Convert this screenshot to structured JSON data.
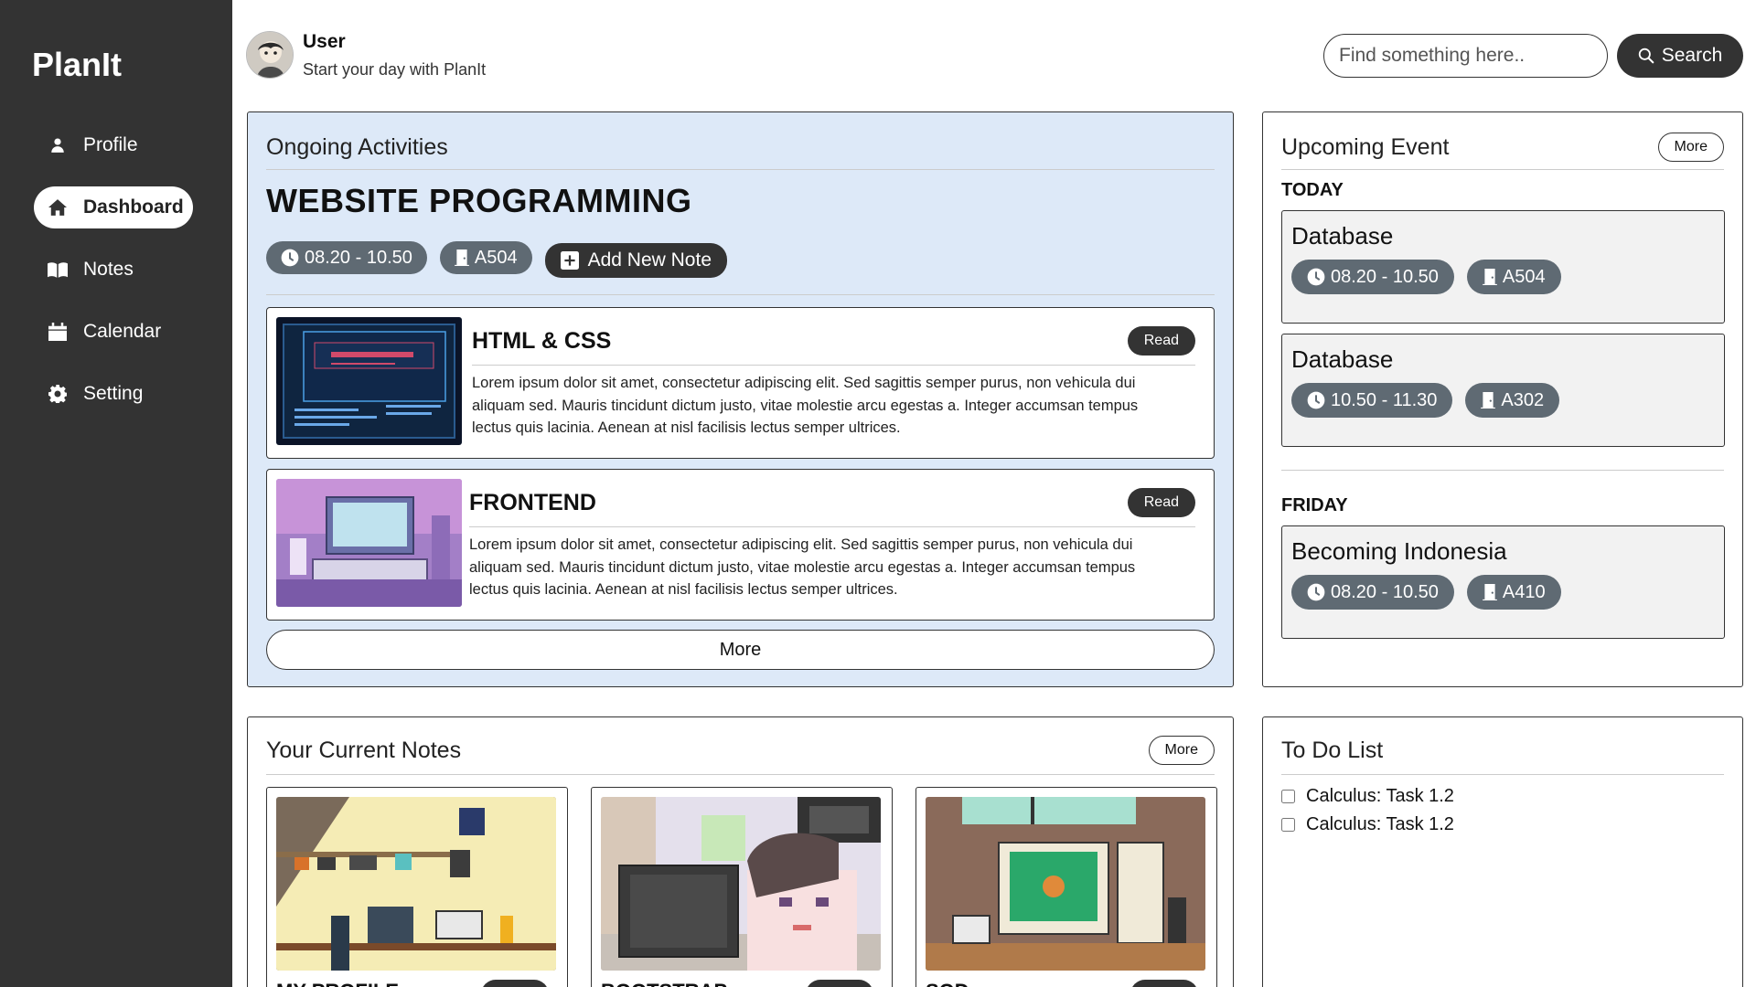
{
  "app": {
    "brand": "PlanIt"
  },
  "sidebar": {
    "items": [
      {
        "label": "Profile",
        "icon": "person-icon",
        "active": false
      },
      {
        "label": "Dashboard",
        "icon": "home-icon",
        "active": true
      },
      {
        "label": "Notes",
        "icon": "book-icon",
        "active": false
      },
      {
        "label": "Calendar",
        "icon": "calendar-icon",
        "active": false
      },
      {
        "label": "Setting",
        "icon": "gear-icon",
        "active": false
      }
    ]
  },
  "header": {
    "user_name": "User",
    "subtitle": "Start your day with PlanIt",
    "search_placeholder": "Find something here..",
    "search_label": "Search"
  },
  "ongoing": {
    "title": "Ongoing Activities",
    "course": "WEBSITE PROGRAMMING",
    "time": "08.20 - 10.50",
    "room": "A504",
    "add_note_label": "Add New Note",
    "items": [
      {
        "title": "HTML & CSS",
        "read_label": "Read",
        "text": "Lorem ipsum dolor sit amet, consectetur adipiscing elit. Sed sagittis semper purus, non vehicula dui aliquam sed. Mauris tincidunt dictum justo, vitae molestie arcu egestas a. Integer accumsan tempus lectus quis lacinia. Aenean at nisl facilisis lectus semper ultrices."
      },
      {
        "title": "FRONTEND",
        "read_label": "Read",
        "text": "Lorem ipsum dolor sit amet, consectetur adipiscing elit. Sed sagittis semper purus, non vehicula dui aliquam sed. Mauris tincidunt dictum justo, vitae molestie arcu egestas a. Integer accumsan tempus lectus quis lacinia. Aenean at nisl facilisis lectus semper ultrices."
      }
    ],
    "more_label": "More"
  },
  "upcoming": {
    "title": "Upcoming Event",
    "more_label": "More",
    "today_label": "TODAY",
    "friday_label": "FRIDAY",
    "events": [
      {
        "title": "Database",
        "time": "08.20 - 10.50",
        "room": "A504"
      },
      {
        "title": "Database",
        "time": "10.50 - 11.30",
        "room": "A302"
      },
      {
        "title": "Becoming Indonesia",
        "time": "08.20 - 10.50",
        "room": "A410"
      }
    ]
  },
  "notes": {
    "title": "Your Current Notes",
    "more_label": "More",
    "cards": [
      {
        "title": "MY PROFILE",
        "read_label": "Read"
      },
      {
        "title": "BOOTSTRAP",
        "read_label": "Read"
      },
      {
        "title": "SQD",
        "read_label": "Read"
      }
    ]
  },
  "todo": {
    "title": "To Do List",
    "items": [
      {
        "label": "Calculus: Task 1.2",
        "checked": false
      },
      {
        "label": "Calculus: Task 1.2",
        "checked": false
      }
    ]
  },
  "colors": {
    "sidebar": "#333333",
    "ongoing_bg": "#dde9f8",
    "pill": "#5f6a73",
    "dark": "#333333"
  }
}
